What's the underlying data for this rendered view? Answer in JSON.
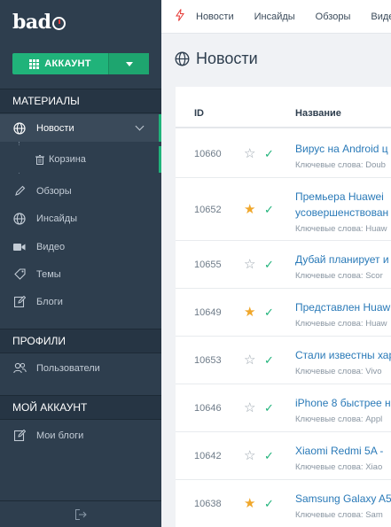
{
  "logo": "bad",
  "account_button": "АККАУНТ",
  "sidebar": {
    "sections": [
      {
        "label": "МАТЕРИАЛЫ"
      },
      {
        "label": "ПРОФИЛИ"
      },
      {
        "label": "МОЙ АККАУНТ"
      }
    ],
    "items": [
      {
        "label": "Новости",
        "icon": "globe-icon"
      },
      {
        "label": "Корзина",
        "icon": "trash-icon"
      },
      {
        "label": "Обзоры",
        "icon": "pencil-icon"
      },
      {
        "label": "Инсайды",
        "icon": "globe-icon"
      },
      {
        "label": "Видео",
        "icon": "video-icon"
      },
      {
        "label": "Темы",
        "icon": "tag-icon"
      },
      {
        "label": "Блоги",
        "icon": "edit-icon"
      },
      {
        "label": "Пользователи",
        "icon": "users-icon"
      },
      {
        "label": "Мои блоги",
        "icon": "edit-icon"
      }
    ]
  },
  "topbar": {
    "links": [
      "Новости",
      "Инсайды",
      "Обзоры",
      "Видео"
    ]
  },
  "page": {
    "title": "Новости"
  },
  "table": {
    "columns": [
      "ID",
      "Название"
    ],
    "keywords_label": "Ключевые слова:",
    "rows": [
      {
        "id": "10660",
        "starred": false,
        "title": [
          "Вирус на Android ц"
        ],
        "kw": "Ключевые слова: Doub"
      },
      {
        "id": "10652",
        "starred": true,
        "title": [
          "Премьера Huawei",
          "усовершенствован"
        ],
        "kw": "Ключевые слова: Huaw"
      },
      {
        "id": "10655",
        "starred": false,
        "title": [
          "Дубай планирует и"
        ],
        "kw": "Ключевые слова: Scor"
      },
      {
        "id": "10649",
        "starred": true,
        "title": [
          "Представлен Huaw"
        ],
        "kw": "Ключевые слова: Huaw"
      },
      {
        "id": "10653",
        "starred": false,
        "title": [
          "Стали известны хар"
        ],
        "kw": "Ключевые слова: Vivo"
      },
      {
        "id": "10646",
        "starred": false,
        "title": [
          "iPhone 8 быстрее н"
        ],
        "kw": "Ключевые слова: Appl"
      },
      {
        "id": "10642",
        "starred": false,
        "title": [
          "Xiaomi Redmi 5A -"
        ],
        "kw": "Ключевые слова: Xiao"
      },
      {
        "id": "10638",
        "starred": true,
        "title": [
          "Samsung Galaxy A5"
        ],
        "kw": "Ключевые слова: Sam"
      }
    ]
  },
  "colors": {
    "sidebar": "#2e3e4e",
    "accent": "#20b37a",
    "link": "#2a7ab8",
    "star": "#f0a72b"
  }
}
